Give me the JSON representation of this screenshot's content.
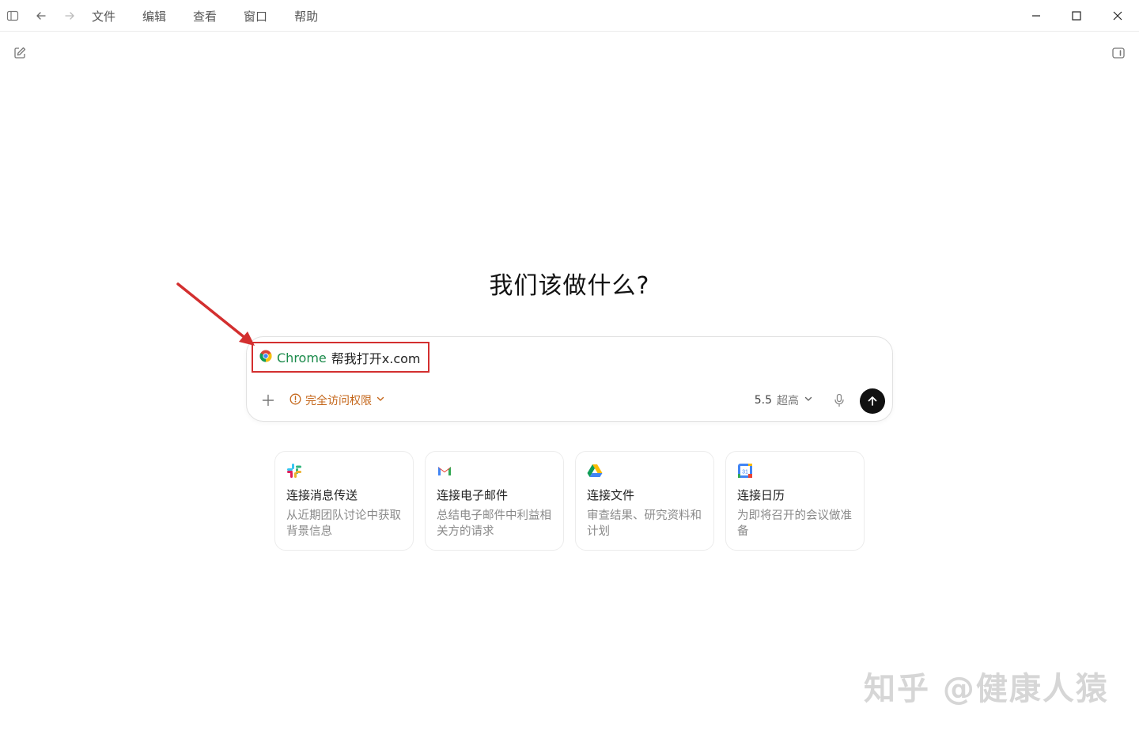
{
  "titlebar": {
    "menu": [
      "文件",
      "编辑",
      "查看",
      "窗口",
      "帮助"
    ]
  },
  "headline": "我们该做什么?",
  "composer": {
    "app_tag": "Chrome",
    "prompt": "帮我打开x.com",
    "access_label": "完全访问权限",
    "model_version": "5.5",
    "model_quality": "超高"
  },
  "cards": [
    {
      "icon": "slack-icon",
      "title": "连接消息传送",
      "desc": "从近期团队讨论中获取背景信息"
    },
    {
      "icon": "gmail-icon",
      "title": "连接电子邮件",
      "desc": "总结电子邮件中利益相关方的请求"
    },
    {
      "icon": "google-drive-icon",
      "title": "连接文件",
      "desc": "审查结果、研究资料和计划"
    },
    {
      "icon": "google-calendar-icon",
      "title": "连接日历",
      "desc": "为即将召开的会议做准备"
    }
  ],
  "calendar_day": "31",
  "watermark": "知乎 @健康人猿",
  "colors": {
    "access_orange": "#c4661a",
    "chrome_green": "#1a8a4a",
    "annotation_red": "#d32f2f",
    "send_button": "#111111"
  }
}
